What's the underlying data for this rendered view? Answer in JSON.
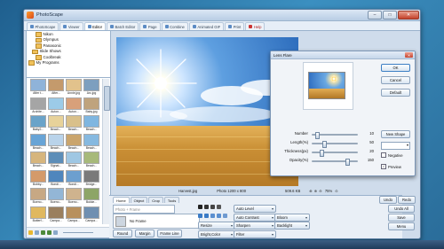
{
  "window": {
    "title": "PhotoScape",
    "minimize": "–",
    "maximize": "□",
    "close": "✕"
  },
  "tabs": [
    {
      "label": "PhotoScape",
      "active": false
    },
    {
      "label": "Viewer",
      "active": false
    },
    {
      "label": "Editor",
      "active": true
    },
    {
      "label": "Batch Editor",
      "active": false
    },
    {
      "label": "Page",
      "active": false
    },
    {
      "label": "Combine",
      "active": false
    },
    {
      "label": "Animated GIF",
      "active": false
    },
    {
      "label": "Print",
      "active": false
    },
    {
      "label": "Help",
      "active": false
    }
  ],
  "tree": [
    "Nikon",
    "Olympus",
    "Panasonic",
    "Slide Shows",
    "Coolbreak",
    "My Programs"
  ],
  "thumbnails": [
    "After t...",
    "After...",
    "Annie.jpg",
    "Arc.jpg",
    "Archite...",
    "Auton...",
    "Auton...",
    "Baby.jpg",
    "Baby2...",
    "Beach...",
    "Beach...",
    "Beach...",
    "Beach...",
    "Beach...",
    "Beach...",
    "Beach...",
    "Beach...",
    "Signat...",
    "Beach...",
    "Beach...",
    "Bobby...",
    "Bondi...",
    "Bondi...",
    "Bridge...",
    "Bueno...",
    "Bueno...",
    "Bueno...",
    "Bukke...",
    "Butterf...",
    "Campa...",
    "Campa...",
    "Campa..."
  ],
  "status": {
    "filename": "Harvest.jpg",
    "dimensions": "Photo 1200 x 800",
    "filesize": "509.6 KB",
    "zoom": "75%"
  },
  "bottom_tabs": [
    "Home",
    "Object",
    "Crop",
    "Tools"
  ],
  "home": {
    "frame_placeholder": "Photo + Frame",
    "frame_select": "No Frame",
    "round": "Round",
    "margin": "Margin",
    "frame_line": "Frame Line",
    "auto_level": "Auto Level",
    "auto_contrast": "Auto Contrast",
    "resize": "Resize",
    "sharpen": "Sharpen",
    "bright_color": "Bright,Color",
    "filter": "Filter",
    "bloom": "Bloom",
    "backlight": "Backlight"
  },
  "side_buttons": {
    "undo": "Undo",
    "redo": "Redo",
    "undo_all": "Undo All",
    "save": "Save",
    "menu": "Menu"
  },
  "dialog": {
    "title": "Lens Flare",
    "ok": "OK",
    "cancel": "Cancel",
    "default": "Default",
    "new_shape": "New Shape",
    "negative": "Negative",
    "preview": "Preview",
    "preview_checked": true,
    "sliders": [
      {
        "label": "Number",
        "value": 10,
        "fraction": 0.1
      },
      {
        "label": "Length(%)",
        "value": 50,
        "fraction": 0.25
      },
      {
        "label": "Thickness(px)",
        "value": 20,
        "fraction": 0.2
      },
      {
        "label": "Opacity(%)",
        "value": 150,
        "fraction": 0.75
      }
    ]
  }
}
